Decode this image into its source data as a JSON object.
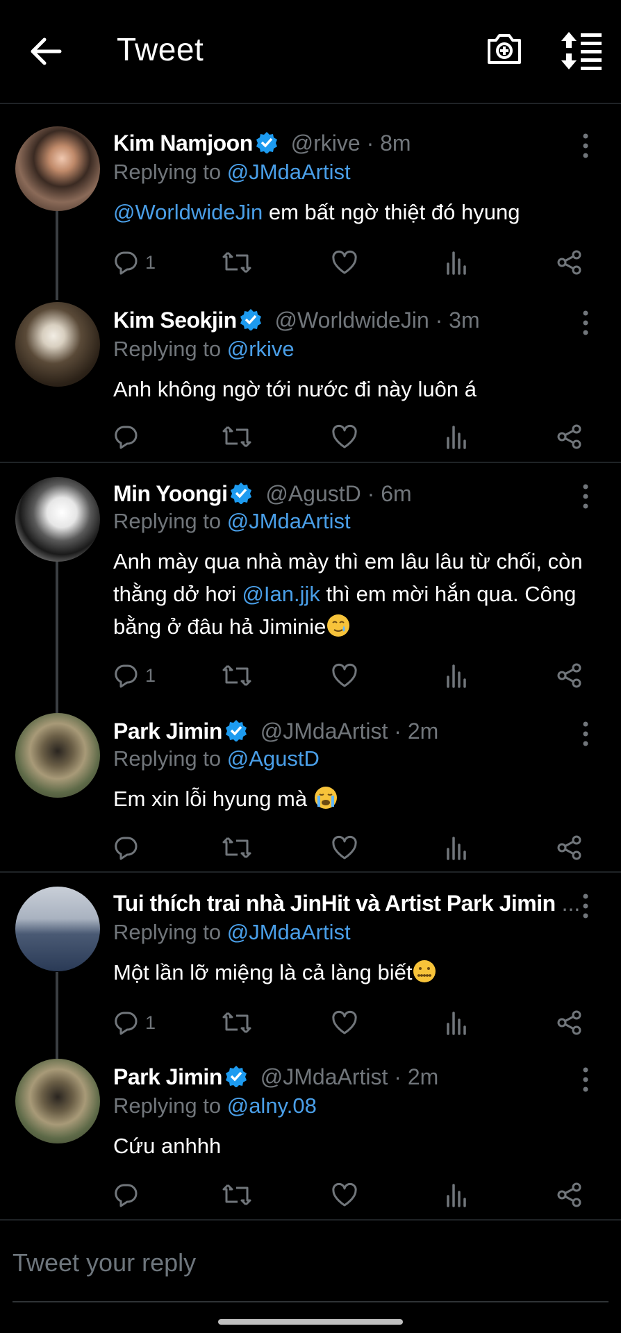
{
  "header": {
    "title": "Tweet"
  },
  "tweets": [
    {
      "name": "Kim Namjoon",
      "handle": "@rkive",
      "time": "· 8m",
      "replying_prefix": "Replying to",
      "replying_to": "@JMdaArtist",
      "mention": "@WorldwideJin",
      "text": " em bất ngờ thiệt đó hyung",
      "replies": "1"
    },
    {
      "name": "Kim Seokjin",
      "handle": "@WorldwideJin",
      "time": "· 3m",
      "replying_prefix": "Replying to",
      "replying_to": "@rkive",
      "text": "Anh không ngờ tới nước đi này luôn á",
      "replies": ""
    },
    {
      "name": "Min Yoongi",
      "handle": "@AgustD",
      "time": "· 6m",
      "replying_prefix": "Replying to",
      "replying_to": "@JMdaArtist",
      "text_a": "Anh mày qua nhà mày thì em lâu lâu từ chối, còn thằng dở hơi ",
      "mention": "@Ian.jjk",
      "text_b": " thì em mời hắn qua. Công bằng ở đâu hả Jiminie",
      "replies": "1"
    },
    {
      "name": "Park Jimin",
      "handle": "@JMdaArtist",
      "time": "· 2m",
      "replying_prefix": "Replying to",
      "replying_to": "@AgustD",
      "text": "Em xin lỗi hyung mà ",
      "replies": ""
    },
    {
      "name": "Tui thích trai nhà JinHit và Artist Park Jimin",
      "ellipsis": "...",
      "replying_prefix": "Replying to",
      "replying_to": "@JMdaArtist",
      "text": "Một lần lỡ miệng là cả làng biết",
      "replies": "1"
    },
    {
      "name": "Park Jimin",
      "handle": "@JMdaArtist",
      "time": "· 2m",
      "replying_prefix": "Replying to",
      "replying_to": "@alny.08",
      "text": "Cứu anhhh",
      "replies": ""
    }
  ],
  "compose": {
    "placeholder": "Tweet your reply"
  },
  "colors": {
    "background": "#000000",
    "accent": "#4a9fe8",
    "verified": "#1d9bf0",
    "muted": "#71767b"
  }
}
